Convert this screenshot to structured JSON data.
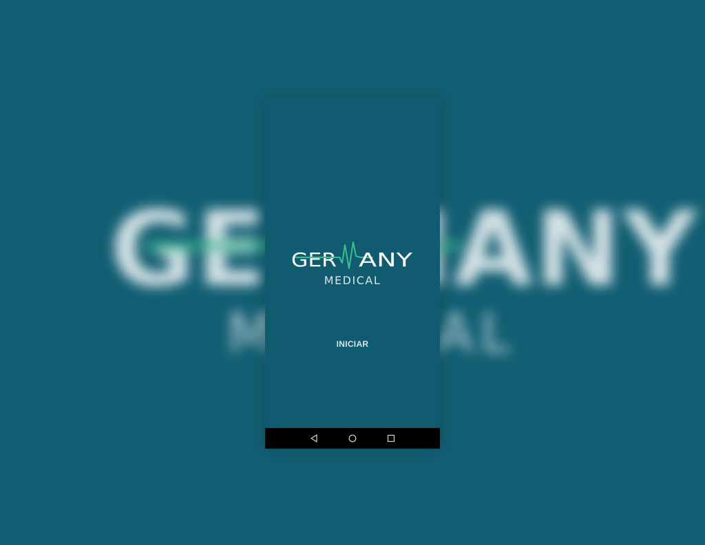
{
  "brand": {
    "name": "GERMANY",
    "subtitle": "MEDICAL",
    "accent_color": "#3bbf8e",
    "text_color": "#ffffff",
    "background_color": "#125e73"
  },
  "screen": {
    "start_label": "INICIAR"
  },
  "navbar": {
    "icons": [
      "back-icon",
      "home-icon",
      "recents-icon"
    ]
  }
}
